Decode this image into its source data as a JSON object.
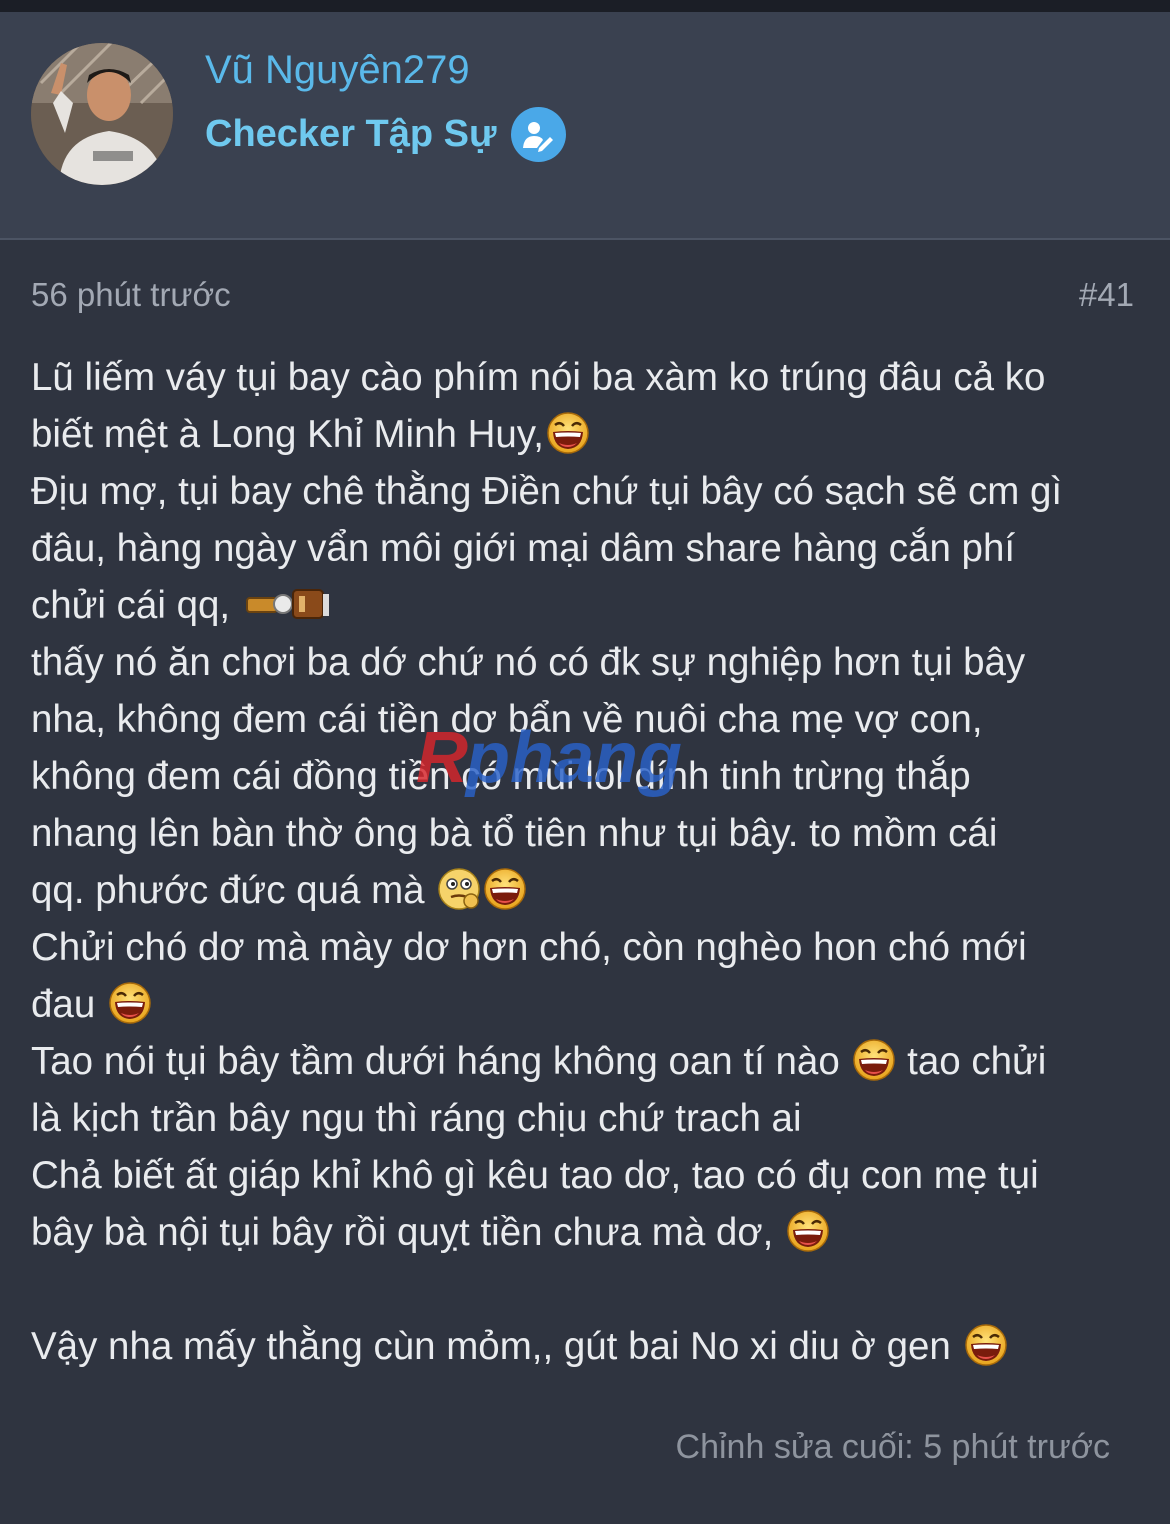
{
  "header": {
    "username": "Vũ Nguyên279",
    "role": "Checker Tập Sự",
    "role_badge_icon": "user-edit-icon"
  },
  "post": {
    "timestamp": "56 phút trước",
    "number": "#41",
    "lines": [
      {
        "text": "Lũ liếm váy tụi bay cào phím nói ba xàm ko trúng đâu cả ko",
        "emoji": ""
      },
      {
        "text": "biết mệt à Long Khỉ Minh Huy,",
        "emoji": "laugh"
      },
      {
        "text": "Địu mợ, tụi bay chê thằng Điền chứ tụi bây có sạch sẽ cm gì",
        "emoji": ""
      },
      {
        "text": "đâu, hàng ngày vẩn môi giới mại dâm share hàng cắn phí",
        "emoji": ""
      },
      {
        "text": "chửi cái qq, ",
        "emoji": "gun"
      },
      {
        "text": "thấy nó ăn chơi ba dớ chứ nó có đk sự nghiệp hơn tụi bây",
        "emoji": ""
      },
      {
        "text": "nha, không đem cái tiền dơ bẩn về nuôi cha mẹ vợ con,",
        "emoji": ""
      },
      {
        "text": "không đem cái đồng tiền có mùi lol dính tinh trừng thắp",
        "emoji": ""
      },
      {
        "text": "nhang lên bàn thờ ông bà tổ tiên như tụi bây. to mồm cái",
        "emoji": ""
      },
      {
        "text": "qq. phước đức quá mà ",
        "emoji": "think-laugh"
      },
      {
        "text": "Chửi chó dơ mà mày dơ hơn chó, còn nghèo hon chó mới",
        "emoji": ""
      },
      {
        "text": "đau ",
        "emoji": "laugh"
      },
      {
        "text": "Tao nói tụi bây tầm dưới háng không oan tí nào ",
        "emoji": "laugh",
        "after": " tao chửi"
      },
      {
        "text": "là kịch trần bây ngu thì ráng chịu chứ trach ai",
        "emoji": ""
      },
      {
        "text": "Chả biết ất giáp khỉ khô gì kêu tao dơ, tao có đụ con mẹ tụi",
        "emoji": ""
      },
      {
        "text": "bây bà nội tụi bây rồi quỵt tiền chưa mà dơ, ",
        "emoji": "laugh"
      },
      {
        "text": "",
        "emoji": ""
      },
      {
        "text": "Vậy nha mấy thằng cùn mỏm,, gút bai No xi diu ờ gen ",
        "emoji": "laugh"
      }
    ],
    "edited": "Chỉnh sửa cuối: 5 phút trước"
  },
  "watermark": {
    "text": "Rphang"
  },
  "colors": {
    "background": "#2f3440",
    "header_bg": "#3a4150",
    "username": "#5ab9ea",
    "role": "#6fc9ef",
    "text": "#e9ebee",
    "muted": "#a3a9b4"
  }
}
